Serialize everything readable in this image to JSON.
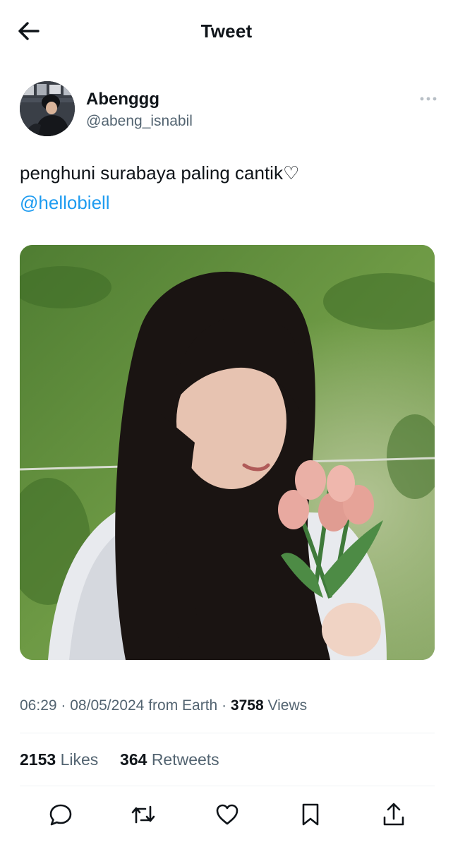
{
  "header": {
    "title": "Tweet",
    "back_icon": "arrow-left-icon"
  },
  "author": {
    "display_name": "Abenggg",
    "handle": "@abeng_isnabil",
    "avatar_icon": "user-avatar"
  },
  "tweet": {
    "text": "penghuni surabaya paling cantik♡",
    "mention": "@hellobiell",
    "media_description_icon": "photo"
  },
  "meta": {
    "time": "06:29",
    "separator": "·",
    "date": "08/05/2024",
    "source": "from Earth",
    "views_count": "3758",
    "views_label": "Views"
  },
  "stats": {
    "likes_count": "2153",
    "likes_label": "Likes",
    "retweets_count": "364",
    "retweets_label": "Retweets"
  },
  "actions": {
    "reply_icon": "reply-icon",
    "retweet_icon": "retweet-icon",
    "like_icon": "heart-icon",
    "bookmark_icon": "bookmark-icon",
    "share_icon": "share-icon"
  },
  "colors": {
    "text": "#0f1419",
    "secondary": "#536471",
    "link": "#1d9bf0",
    "divider": "#eff3f4"
  }
}
